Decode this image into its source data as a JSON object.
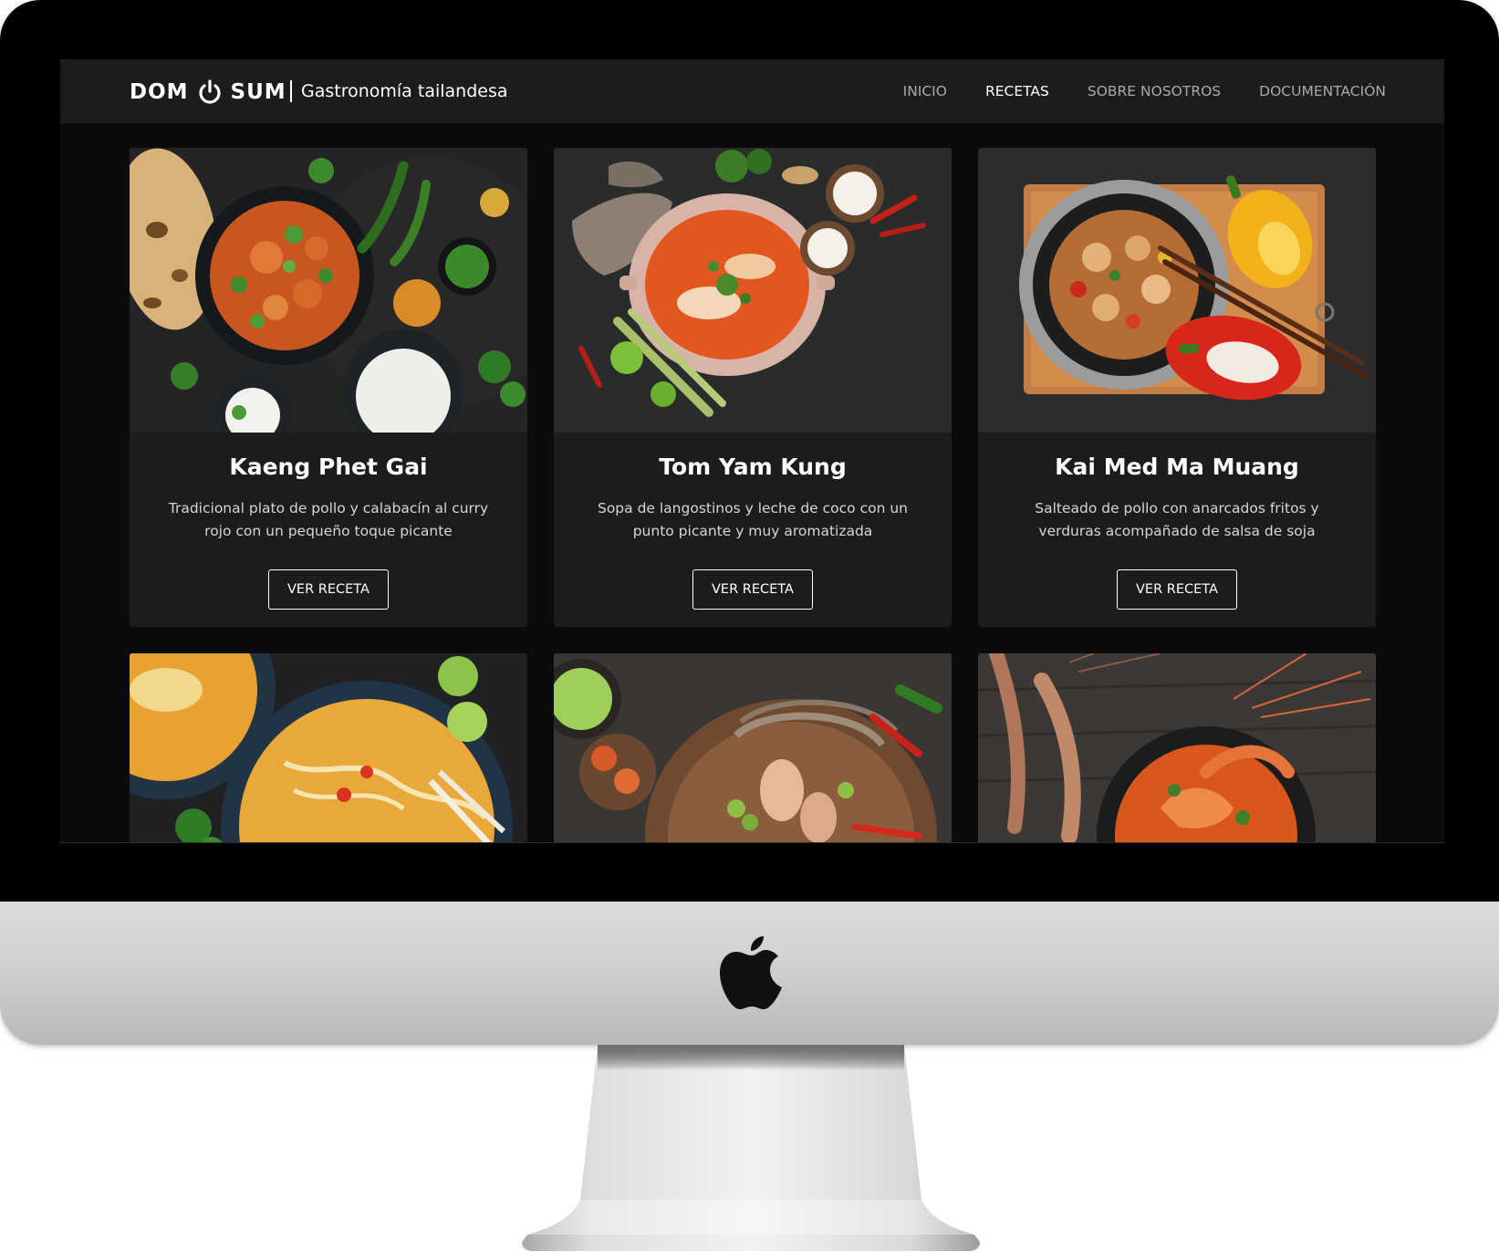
{
  "brand": {
    "logo_left": "DOM",
    "logo_right": "SUM",
    "tagline": "Gastronomía tailandesa"
  },
  "nav": {
    "items": [
      {
        "label": "INICIO",
        "active": false
      },
      {
        "label": "RECETAS",
        "active": true
      },
      {
        "label": "SOBRE NOSOTROS",
        "active": false
      },
      {
        "label": "DOCUMENTACIÓN",
        "active": false
      }
    ]
  },
  "recipes": [
    {
      "title": "Kaeng Phet Gai",
      "description": "Tradicional plato de pollo y calabacín al curry rojo con un pequeño toque picante",
      "button": "VER RECETA"
    },
    {
      "title": "Tom Yam Kung",
      "description": "Sopa de langostinos y leche de coco con un punto picante y muy aromatizada",
      "button": "VER RECETA"
    },
    {
      "title": "Kai Med Ma Muang",
      "description": "Salteado de pollo con anarcados fritos y verduras acompañado de salsa de soja",
      "button": "VER RECETA"
    }
  ],
  "colors": {
    "navbar_bg": "#1b1c1c",
    "page_bg": "#0b0b0b",
    "card_bg": "#1b1c1c",
    "nav_active": "#ffffff",
    "nav_inactive": "#a9a9a9"
  },
  "icons": {
    "logo_glyph": "power-icon",
    "device_logo": "apple-logo-icon"
  }
}
